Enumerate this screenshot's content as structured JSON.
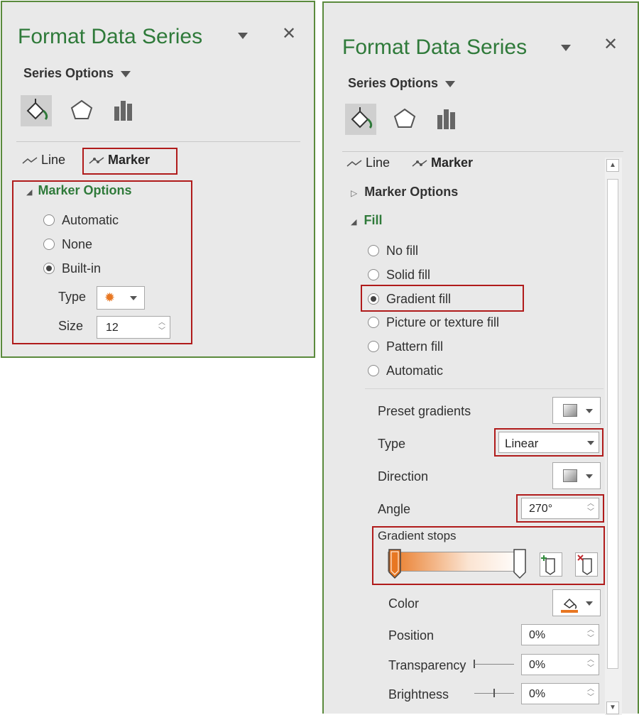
{
  "left_panel": {
    "title": "Format Data Series",
    "series_options": "Series Options",
    "subtabs": {
      "line": "Line",
      "marker": "Marker"
    },
    "section": "Marker Options",
    "radios": [
      {
        "label": "Automatic",
        "selected": false
      },
      {
        "label": "None",
        "selected": false
      },
      {
        "label": "Built-in",
        "selected": true
      }
    ],
    "type_label": "Type",
    "size_label": "Size",
    "size_value": "12",
    "marker_color": "#e87722"
  },
  "right_panel": {
    "title": "Format Data Series",
    "series_options": "Series Options",
    "subtabs": {
      "line": "Line",
      "marker": "Marker"
    },
    "marker_options": "Marker Options",
    "fill": "Fill",
    "fill_radios": [
      {
        "label": "No fill",
        "selected": false
      },
      {
        "label": "Solid fill",
        "selected": false
      },
      {
        "label": "Gradient fill",
        "selected": true
      },
      {
        "label": "Picture or texture fill",
        "selected": false
      },
      {
        "label": "Pattern fill",
        "selected": false
      },
      {
        "label": "Automatic",
        "selected": false
      }
    ],
    "preset_gradients": "Preset gradients",
    "type_label": "Type",
    "type_value": "Linear",
    "direction": "Direction",
    "angle_label": "Angle",
    "angle_value": "270°",
    "gradient_stops": "Gradient stops",
    "color": "Color",
    "position_label": "Position",
    "position_value": "0%",
    "transparency_label": "Transparency",
    "transparency_value": "0%",
    "brightness_label": "Brightness",
    "brightness_value": "0%",
    "accent_color": "#e87722"
  }
}
